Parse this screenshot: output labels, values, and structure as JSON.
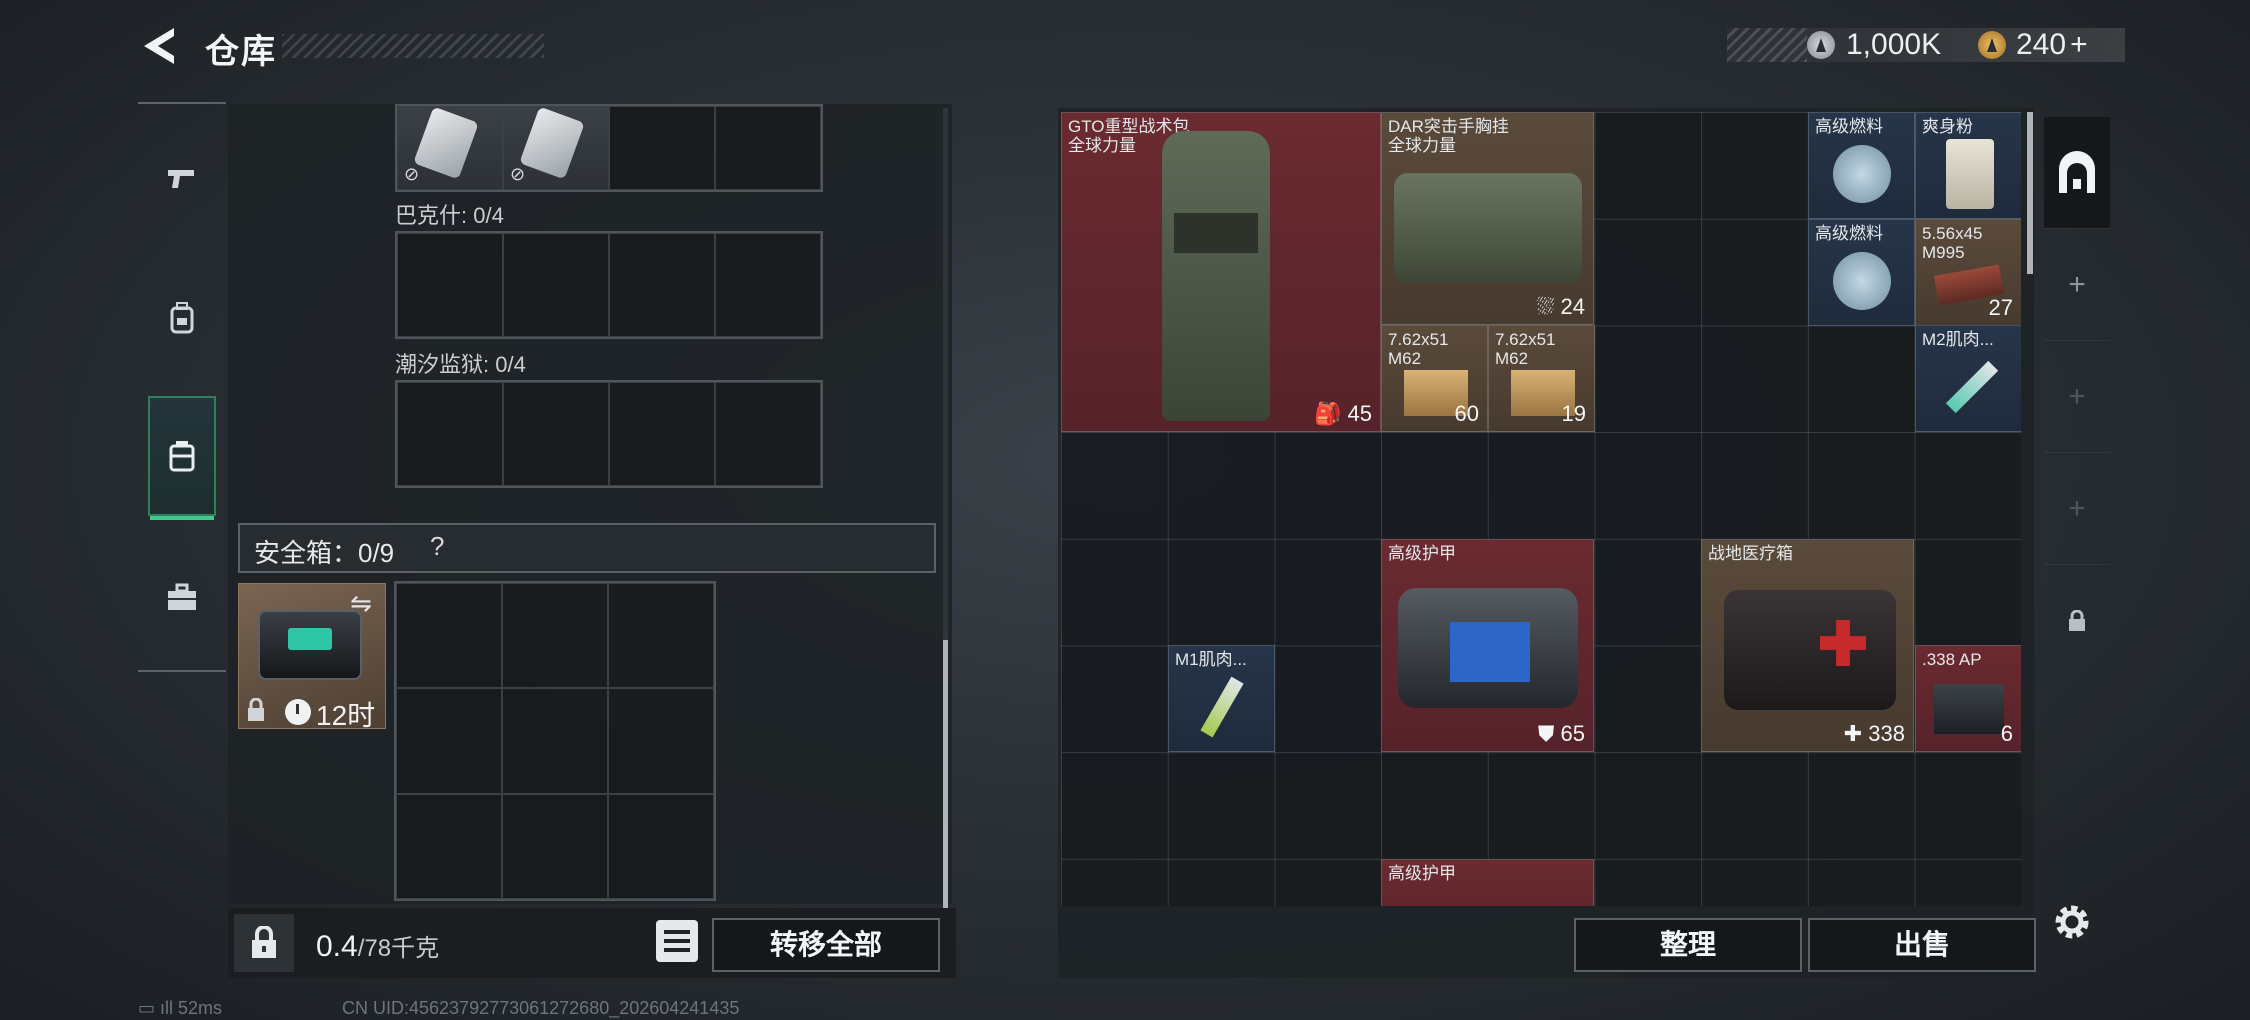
{
  "header": {
    "title": "仓库",
    "silver_value": "1,000K",
    "gold_value": "240",
    "gold_add": "+"
  },
  "left_rail": {
    "tabs": [
      {
        "name": "weapon-tab",
        "icon": "pistol-icon"
      },
      {
        "name": "gear-tab",
        "icon": "backpack-icon"
      },
      {
        "name": "container-tab",
        "icon": "case-icon",
        "active": true
      },
      {
        "name": "toolbox-tab",
        "icon": "briefcase-icon"
      }
    ]
  },
  "pouches": {
    "top_card_tags": [
      "⊘",
      "⊘"
    ],
    "bakeshi_label": "巴克什: 0/4",
    "chaoxi_label": "潮汐监狱: 0/4"
  },
  "safe_box": {
    "label": "安全箱：0/9",
    "help": "?",
    "timer": "12时"
  },
  "left_footer": {
    "weight_value": "0.4",
    "weight_max": "/78千克",
    "transfer_all": "转移全部"
  },
  "items": [
    {
      "name": "GTO重型战术包",
      "sub": "全球力量",
      "count": "45",
      "count_icon": "backpack-icon"
    },
    {
      "name": "DAR突击手胸挂",
      "sub": "全球力量",
      "count": "24",
      "count_icon": "vest-icon"
    },
    {
      "name": "高级燃料",
      "count": ""
    },
    {
      "name": "爽身粉",
      "count": ""
    },
    {
      "name": "高级燃料",
      "count": ""
    },
    {
      "name": "5.56x45 M995",
      "count": "27"
    },
    {
      "name": "7.62x51 M62",
      "count": "60"
    },
    {
      "name": "7.62x51 M62",
      "count": "19"
    },
    {
      "name": "M2肌肉...",
      "count": ""
    },
    {
      "name": "高级护甲",
      "count": "65",
      "count_icon": "shield-icon"
    },
    {
      "name": "战地医疗箱",
      "count": "338",
      "count_icon": "plus-icon"
    },
    {
      "name": "M1肌肉...",
      "count": ""
    },
    {
      "name": ".338 AP",
      "count": "6"
    },
    {
      "name": "高级护甲",
      "count": ""
    }
  ],
  "right_footer": {
    "sort": "整理",
    "sell": "出售"
  },
  "status": {
    "ping": "52ms",
    "uid": "CN UID:45623792773061272680_202604241435"
  },
  "colors": {
    "accent_green": "#3fc98a",
    "item_red": "#6a2a30",
    "item_brown": "#5a4a3b",
    "item_blue": "#27354a"
  }
}
